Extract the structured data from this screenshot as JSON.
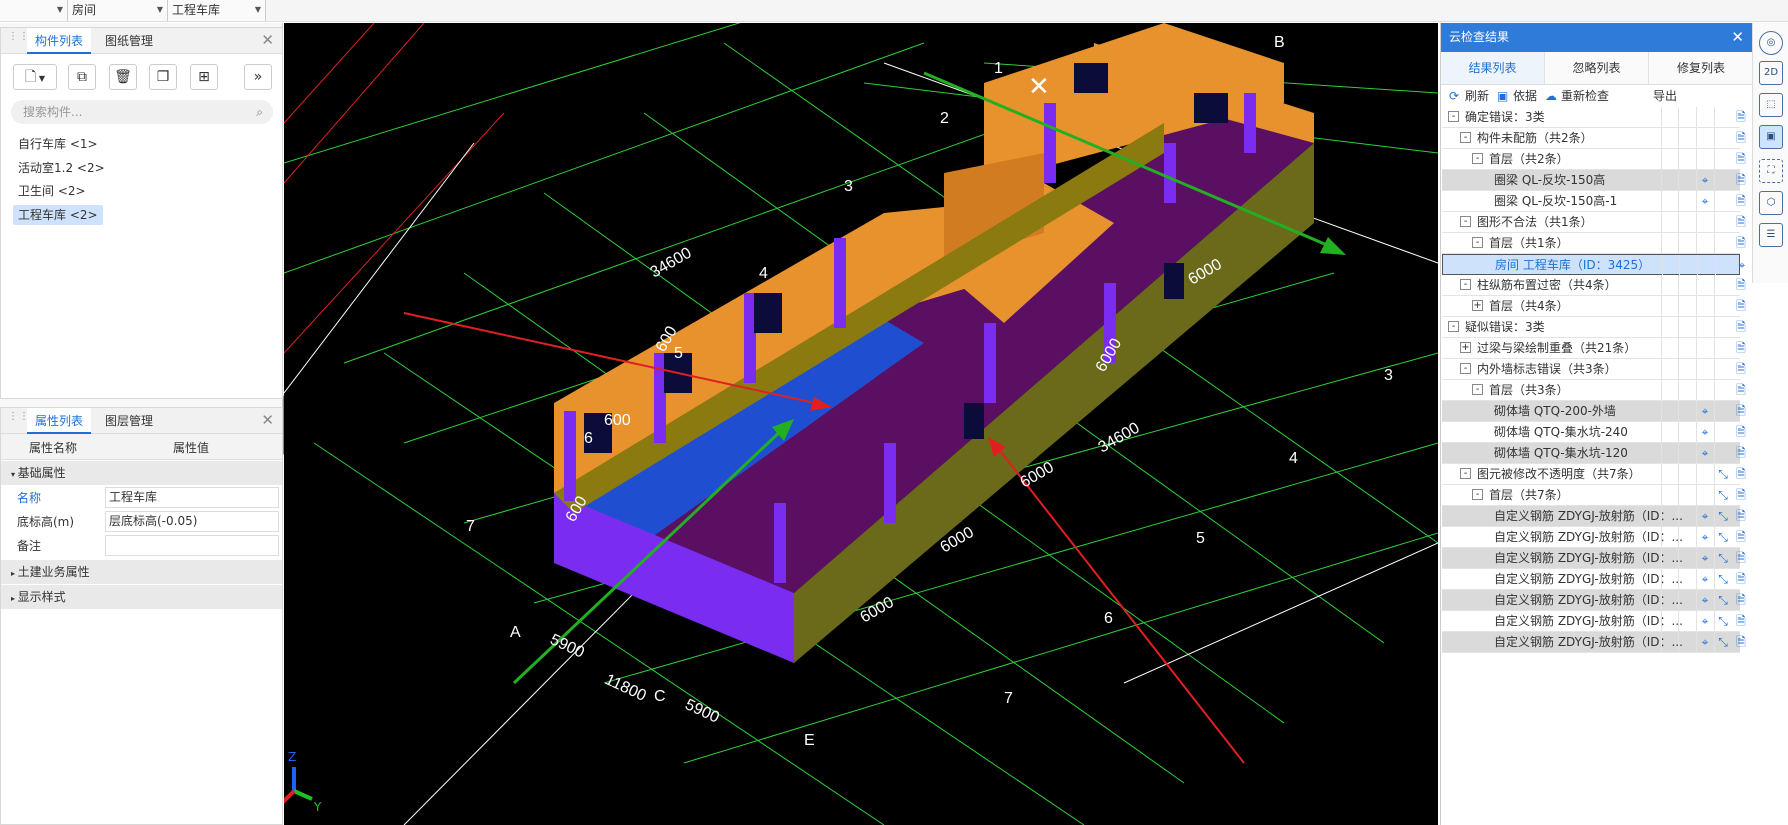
{
  "topbar": {
    "combo1": "",
    "combo2": "房间",
    "combo3": "工程车库"
  },
  "component_panel": {
    "tabs": [
      "构件列表",
      "图纸管理"
    ],
    "search_placeholder": "搜索构件...",
    "items": [
      "自行车库 <1>",
      "活动室1.2 <2>",
      "卫生间 <2>",
      "工程车库 <2>"
    ],
    "selected_index": 3
  },
  "property_panel": {
    "tabs": [
      "属性列表",
      "图层管理"
    ],
    "col_name": "属性名称",
    "col_value": "属性值",
    "section_basic": "基础属性",
    "rows": [
      {
        "name": "名称",
        "value": "工程车库"
      },
      {
        "name": "底标高(m)",
        "value": "层底标高(-0.05)"
      },
      {
        "name": "备注",
        "value": ""
      }
    ],
    "section_civil": "土建业务属性",
    "section_display": "显示样式"
  },
  "viewport": {
    "dims": [
      "34600",
      "34600",
      "6000",
      "6000",
      "6000",
      "6000",
      "6000",
      "5900",
      "5900",
      "11800",
      "600",
      "600"
    ],
    "grid_numbers": [
      "1",
      "2",
      "3",
      "4",
      "5",
      "6",
      "7"
    ],
    "grid_letters": [
      "A",
      "B",
      "C",
      "E"
    ],
    "axis_labels": {
      "x": "X",
      "y": "Y",
      "z": "Z"
    }
  },
  "cloud_check": {
    "title": "云检查结果",
    "tabs": [
      "结果列表",
      "忽略列表",
      "修复列表"
    ],
    "actions": {
      "refresh": "刷新",
      "basis": "依据",
      "recheck": "重新检查",
      "export": "导出"
    },
    "tree": [
      {
        "level": 0,
        "label": "确定错误：3类",
        "box": "-",
        "icons": [
          "file"
        ]
      },
      {
        "level": 1,
        "label": "构件未配筋（共2条）",
        "box": "-",
        "icons": [
          "file"
        ]
      },
      {
        "level": 2,
        "label": "首层（共2条）",
        "box": "-",
        "icons": [
          "file"
        ]
      },
      {
        "level": 3,
        "label": "圈梁 QL-反坎-150高",
        "box": "",
        "icons": [
          "loc",
          "file"
        ],
        "hl": true
      },
      {
        "level": 3,
        "label": "圈梁 QL-反坎-150高-1",
        "box": "",
        "icons": [
          "loc",
          "file"
        ]
      },
      {
        "level": 1,
        "label": "图形不合法（共1条）",
        "box": "-",
        "icons": [
          "file"
        ]
      },
      {
        "level": 2,
        "label": "首层（共1条）",
        "box": "-",
        "icons": [
          "file"
        ]
      },
      {
        "level": 3,
        "label": "房间 工程车库（ID：3425）",
        "box": "",
        "icons": [
          "loc"
        ],
        "sel": true
      },
      {
        "level": 1,
        "label": "柱纵筋布置过密（共4条）",
        "box": "-",
        "icons": [
          "file"
        ]
      },
      {
        "level": 2,
        "label": "首层（共4条）",
        "box": "+",
        "icons": [
          "file"
        ]
      },
      {
        "level": 0,
        "label": "疑似错误：3类",
        "box": "-",
        "icons": [
          "file"
        ]
      },
      {
        "level": 1,
        "label": "过梁与梁绘制重叠（共21条）",
        "box": "+",
        "icons": [
          "file"
        ]
      },
      {
        "level": 1,
        "label": "内外墙标志错误（共3条）",
        "box": "-",
        "icons": [
          "file"
        ]
      },
      {
        "level": 2,
        "label": "首层（共3条）",
        "box": "-",
        "icons": [
          "file"
        ]
      },
      {
        "level": 3,
        "label": "砌体墙 QTQ-200-外墙",
        "box": "",
        "icons": [
          "loc",
          "file"
        ],
        "hl": true
      },
      {
        "level": 3,
        "label": "砌体墙 QTQ-集水坑-240",
        "box": "",
        "icons": [
          "loc",
          "file"
        ]
      },
      {
        "level": 3,
        "label": "砌体墙 QTQ-集水坑-120",
        "box": "",
        "icons": [
          "loc",
          "file"
        ],
        "hl": true
      },
      {
        "level": 1,
        "label": "图元被修改不透明度（共7条）",
        "box": "-",
        "icons": [
          "fix",
          "file"
        ]
      },
      {
        "level": 2,
        "label": "首层（共7条）",
        "box": "-",
        "icons": [
          "fix",
          "file"
        ]
      },
      {
        "level": 3,
        "label": "自定义钢筋 ZDYGJ-放射筋（ID：...",
        "box": "",
        "icons": [
          "loc",
          "fix",
          "file"
        ],
        "hl": true
      },
      {
        "level": 3,
        "label": "自定义钢筋 ZDYGJ-放射筋（ID：...",
        "box": "",
        "icons": [
          "loc",
          "fix",
          "file"
        ]
      },
      {
        "level": 3,
        "label": "自定义钢筋 ZDYGJ-放射筋（ID：...",
        "box": "",
        "icons": [
          "loc",
          "fix",
          "file"
        ],
        "hl": true
      },
      {
        "level": 3,
        "label": "自定义钢筋 ZDYGJ-放射筋（ID：...",
        "box": "",
        "icons": [
          "loc",
          "fix",
          "file"
        ]
      },
      {
        "level": 3,
        "label": "自定义钢筋 ZDYGJ-放射筋（ID：...",
        "box": "",
        "icons": [
          "loc",
          "fix",
          "file"
        ],
        "hl": true
      },
      {
        "level": 3,
        "label": "自定义钢筋 ZDYGJ-放射筋（ID：...",
        "box": "",
        "icons": [
          "loc",
          "fix",
          "file"
        ]
      },
      {
        "level": 3,
        "label": "自定义钢筋 ZDYGJ-放射筋（ID：...",
        "box": "",
        "icons": [
          "loc",
          "fix",
          "file"
        ],
        "hl": true
      }
    ]
  },
  "sidebar": {
    "buttons": [
      "orbit-icon",
      "2d-view-icon",
      "3d-box-icon",
      "solid-box-icon",
      "fit-view-icon",
      "layer-cube-icon",
      "checklist-icon"
    ],
    "label_2d": "2D"
  },
  "colors": {
    "accent": "#2f7bd9",
    "wall": "#e8922e",
    "floor": "#1f4fd0",
    "slab": "#5a0f62",
    "column": "#7a2cf0",
    "grid": "#33d633"
  }
}
